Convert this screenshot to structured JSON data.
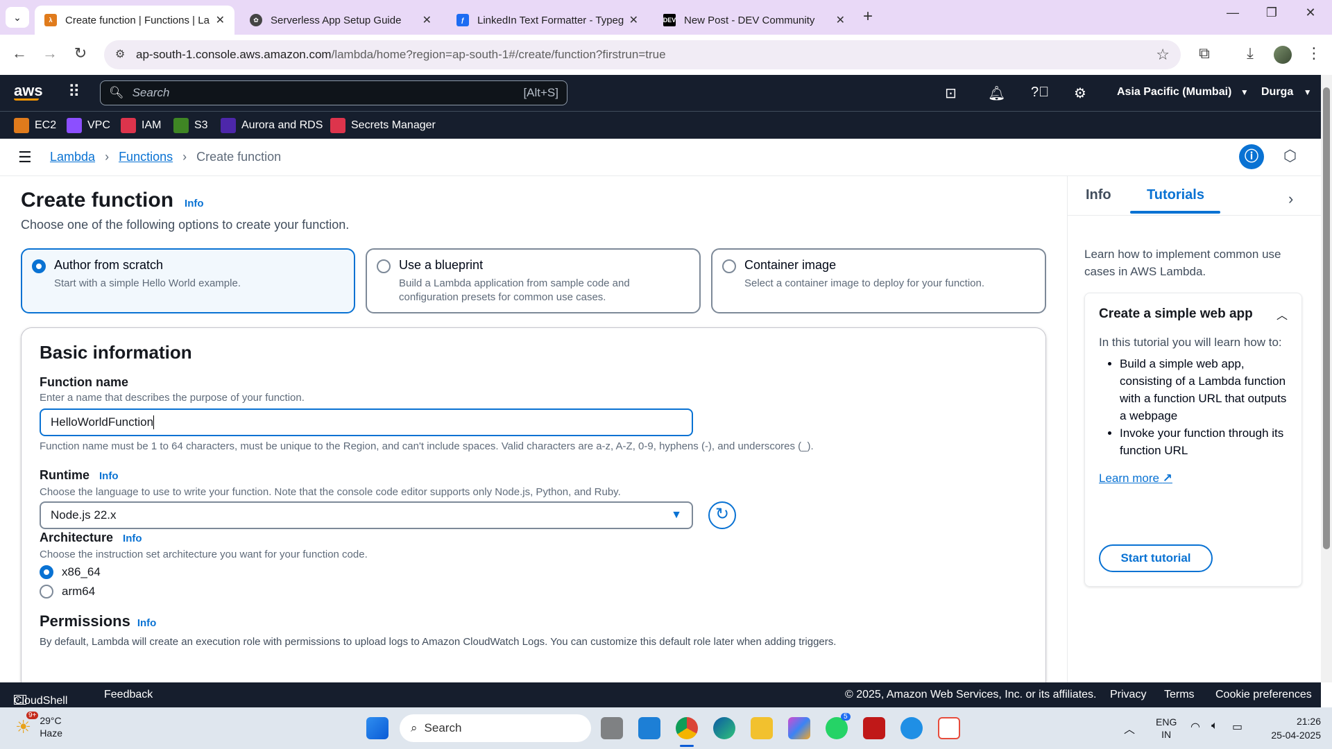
{
  "browser": {
    "tabs": [
      {
        "title": "Create function | Functions | La",
        "favicon": "aws-lambda-icon"
      },
      {
        "title": "Serverless App Setup Guide",
        "favicon": "openai-icon"
      },
      {
        "title": "LinkedIn Text Formatter - Typeg",
        "favicon": "typegrow-icon"
      },
      {
        "title": "New Post - DEV Community",
        "favicon": "dev-icon"
      }
    ],
    "url_host": "ap-south-1.console.aws.amazon.com",
    "url_path": "/lambda/home?region=ap-south-1#/create/function?firstrun=true"
  },
  "aws": {
    "logo": "aws",
    "search_placeholder": "Search",
    "search_shortcut": "[Alt+S]",
    "region": "Asia Pacific (Mumbai)",
    "user": "Durga",
    "favorites": [
      {
        "label": "EC2",
        "color": "#e07b1c"
      },
      {
        "label": "VPC",
        "color": "#8c4fff"
      },
      {
        "label": "IAM",
        "color": "#dd344c"
      },
      {
        "label": "S3",
        "color": "#3f8624"
      },
      {
        "label": "Aurora and RDS",
        "color": "#4d27aa"
      },
      {
        "label": "Secrets Manager",
        "color": "#dd344c"
      }
    ]
  },
  "breadcrumb": {
    "items": [
      "Lambda",
      "Functions",
      "Create function"
    ]
  },
  "page": {
    "title": "Create function",
    "info": "Info",
    "subtitle": "Choose one of the following options to create your function.",
    "options": [
      {
        "title": "Author from scratch",
        "desc": "Start with a simple Hello World example.",
        "selected": true
      },
      {
        "title": "Use a blueprint",
        "desc": "Build a Lambda application from sample code and configuration presets for common use cases.",
        "selected": false
      },
      {
        "title": "Container image",
        "desc": "Select a container image to deploy for your function.",
        "selected": false
      }
    ]
  },
  "basic": {
    "heading": "Basic information",
    "fn_label": "Function name",
    "fn_desc": "Enter a name that describes the purpose of your function.",
    "fn_value": "HelloWorldFunction",
    "fn_constraint": "Function name must be 1 to 64 characters, must be unique to the Region, and can't include spaces. Valid characters are a-z, A-Z, 0-9, hyphens (-), and underscores (_).",
    "runtime_label": "Runtime",
    "runtime_info": "Info",
    "runtime_desc": "Choose the language to use to write your function. Note that the console code editor supports only Node.js, Python, and Ruby.",
    "runtime_value": "Node.js 22.x",
    "arch_label": "Architecture",
    "arch_info": "Info",
    "arch_desc": "Choose the instruction set architecture you want for your function code.",
    "arch_options": [
      {
        "label": "x86_64",
        "selected": true
      },
      {
        "label": "arm64",
        "selected": false
      }
    ],
    "perm_label": "Permissions",
    "perm_info": "Info",
    "perm_desc": "By default, Lambda will create an execution role with permissions to upload logs to Amazon CloudWatch Logs. You can customize this default role later when adding triggers."
  },
  "side": {
    "tabs": [
      "Info",
      "Tutorials"
    ],
    "active_tab": "Tutorials",
    "intro": "Learn how to implement common use cases in AWS Lambda.",
    "tutorial_title": "Create a simple web app",
    "tutorial_intro": "In this tutorial you will learn how to:",
    "tutorial_items": [
      "Build a simple web app, consisting of a Lambda function with a function URL that outputs a webpage",
      "Invoke your function through its function URL"
    ],
    "learn_more": "Learn more",
    "start_button": "Start tutorial"
  },
  "footer": {
    "cloudshell": "CloudShell",
    "feedback": "Feedback",
    "copyright": "© 2025, Amazon Web Services, Inc. or its affiliates.",
    "privacy": "Privacy",
    "terms": "Terms",
    "cookie": "Cookie preferences"
  },
  "taskbar": {
    "temp": "29°C",
    "weather": "Haze",
    "weather_badge": "9+",
    "search": "Search",
    "whatsapp_badge": "5",
    "lang1": "ENG",
    "lang2": "IN",
    "time": "21:26",
    "date": "25-04-2025"
  },
  "colors": {
    "accent": "#0972d3",
    "aws_nav": "#161e2d",
    "tab_strip": "#e9d9f7"
  }
}
